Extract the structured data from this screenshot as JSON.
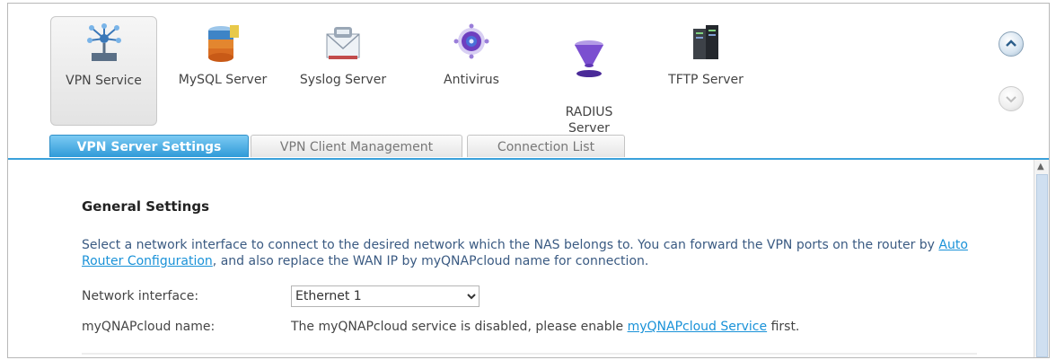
{
  "apps": [
    {
      "id": "vpn",
      "label": "VPN Service",
      "icon": "network-hub-icon",
      "selected": true
    },
    {
      "id": "mysql",
      "label": "MySQL Server",
      "icon": "database-icon",
      "selected": false
    },
    {
      "id": "syslog",
      "label": "Syslog Server",
      "icon": "mail-log-icon",
      "selected": false
    },
    {
      "id": "antivirus",
      "label": "Antivirus",
      "icon": "virus-icon",
      "selected": false
    },
    {
      "id": "radius",
      "label": "RADIUS\nServer",
      "icon": "funnel-icon",
      "selected": false
    },
    {
      "id": "tftp",
      "label": "TFTP Server",
      "icon": "server-icon",
      "selected": false
    }
  ],
  "tabs": [
    {
      "label": "VPN Server Settings",
      "active": true
    },
    {
      "label": "VPN Client Management",
      "active": false
    },
    {
      "label": "Connection List",
      "active": false
    }
  ],
  "content": {
    "section_title": "General Settings",
    "desc_part1": "Select a network interface to connect to the desired network which the NAS belongs to. You can forward the VPN ports on the router by ",
    "desc_link": "Auto Router Configuration",
    "desc_part2": ", and also replace the WAN IP by myQNAPcloud name for connection.",
    "network_interface_label": "Network interface:",
    "network_interface_value": "Ethernet 1",
    "myqnapcloud_label": "myQNAPcloud name:",
    "myqnapcloud_text": "The myQNAPcloud service is disabled, please enable ",
    "myqnapcloud_link": "myQNAPcloud Service",
    "myqnapcloud_tail": " first."
  }
}
